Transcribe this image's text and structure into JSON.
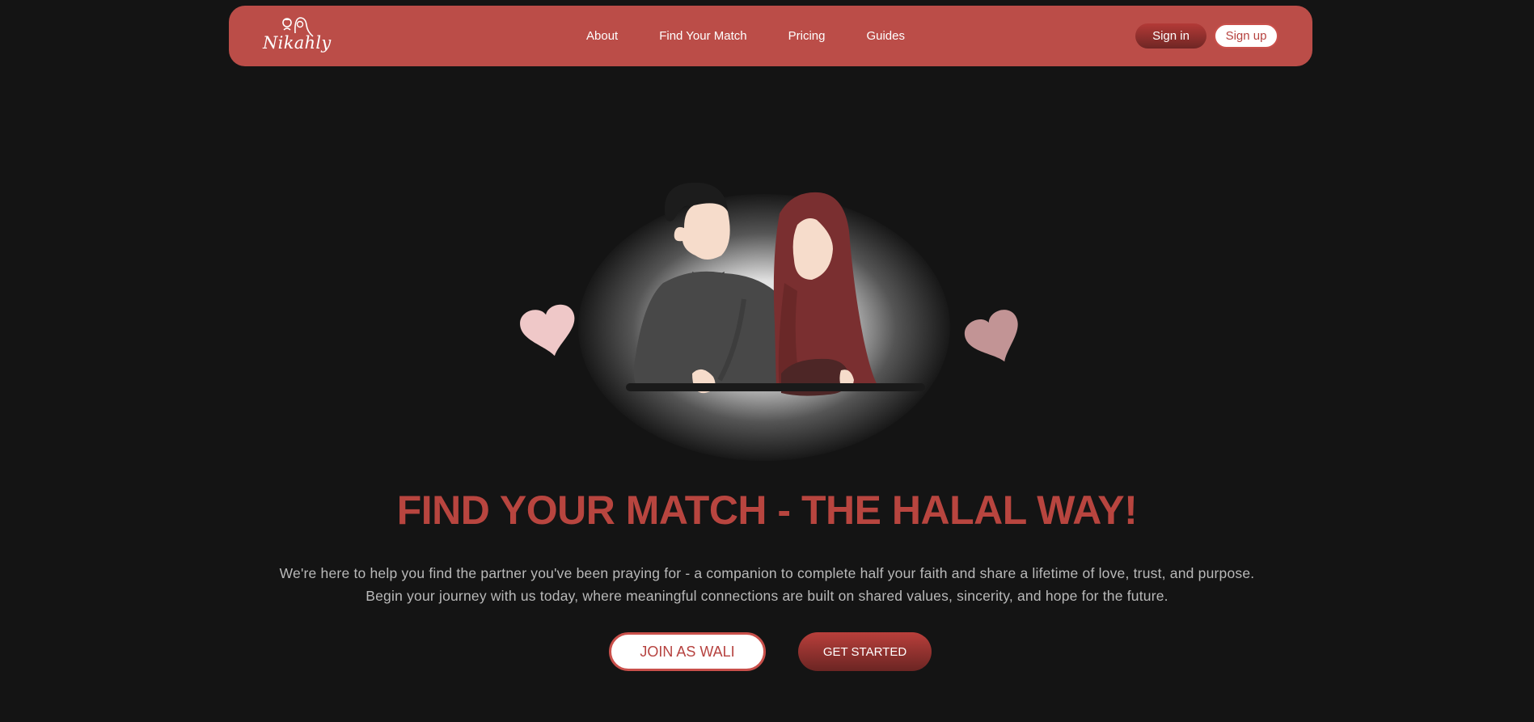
{
  "brand": {
    "name": "Nikahly",
    "accent": "#bb4d48",
    "background": "#141414"
  },
  "nav": {
    "links": [
      "About",
      "Find Your Match",
      "Pricing",
      "Guides"
    ],
    "signin_label": "Sign in",
    "signup_label": "Sign up"
  },
  "hero": {
    "title": "FIND YOUR MATCH - THE HALAL WAY!",
    "subtitle_line1": "We're here to help you find the partner you've been praying for - a companion to complete half your faith and share a lifetime of love, trust, and purpose.",
    "subtitle_line2": "Begin your journey with us today, where meaningful connections are built on shared values, sincerity, and hope for the future.",
    "primary_cta": "JOIN AS WALI",
    "secondary_cta": "GET STARTED"
  },
  "illustration": {
    "icons": [
      "couple-illustration",
      "heart-icon",
      "heart-icon"
    ]
  }
}
